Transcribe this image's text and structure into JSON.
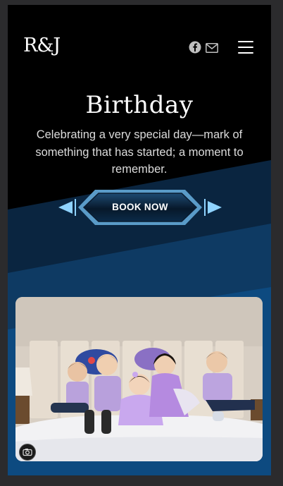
{
  "header": {
    "logo_text": "R&J",
    "icons": [
      "facebook-icon",
      "mail-icon",
      "hamburger-menu-icon"
    ]
  },
  "hero": {
    "title": "Birthday",
    "subtitle": "Celebrating a very special day—mark of something that has started; a moment to remember.",
    "cta_label": "BOOK NOW"
  },
  "photo": {
    "subject": "children-on-bed-photo",
    "badge_icon": "camera-icon"
  },
  "colors": {
    "background": "#000000",
    "wave_dark": "#0a2540",
    "wave_mid": "#0e3a63",
    "wave_light": "#0d4a80",
    "accent_light_blue": "#8fd3ff",
    "page_outer": "#2b2b2d"
  }
}
